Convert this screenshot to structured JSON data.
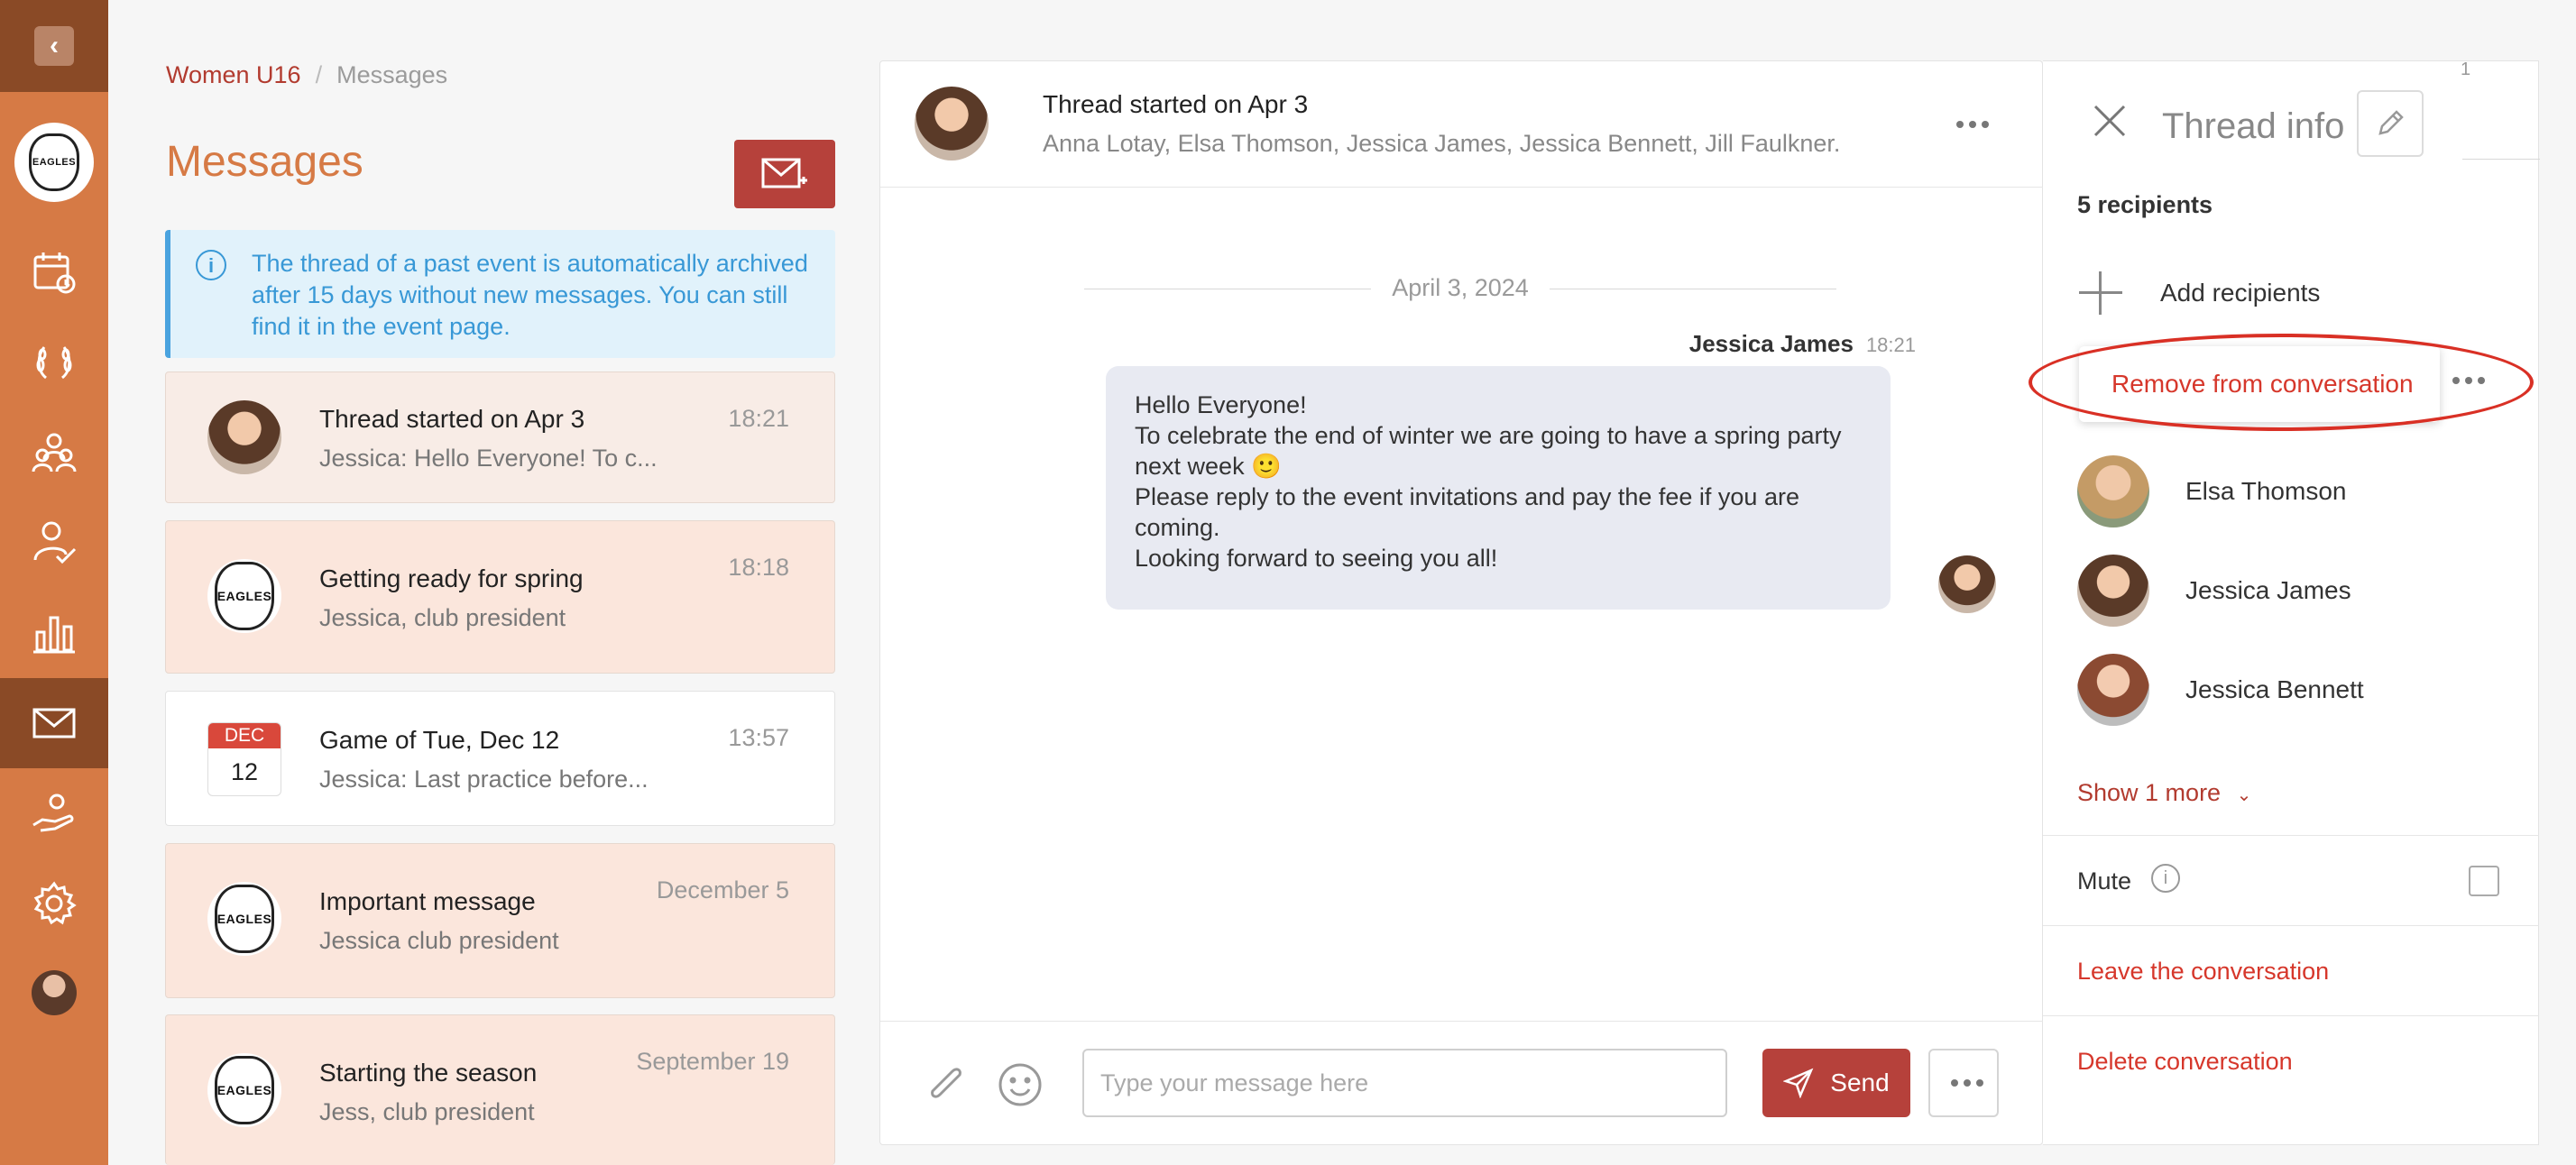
{
  "sidebar": {
    "back_icon": "chevron-left-icon",
    "logo_text": "EAGLES",
    "items": [
      {
        "icon": "calendar-icon"
      },
      {
        "icon": "laurel-icon"
      },
      {
        "icon": "team-icon"
      },
      {
        "icon": "attendance-icon"
      },
      {
        "icon": "stats-icon"
      },
      {
        "icon": "mail-icon",
        "active": true
      },
      {
        "icon": "hand-heart-icon"
      },
      {
        "icon": "gear-icon"
      }
    ]
  },
  "breadcrumb": {
    "team": "Women U16",
    "sep": "/",
    "page": "Messages"
  },
  "page_title": "Messages",
  "info_banner": "The thread of a past event is automatically archived after 15 days without new messages. You can still find it in the event page.",
  "threads": [
    {
      "title": "Thread started on Apr 3",
      "preview": "Jessica: Hello Everyone! To c...",
      "time": "18:21"
    },
    {
      "title": "Getting ready for spring",
      "preview": "Jessica, club president",
      "time": "18:18",
      "logo_text": "EAGLES"
    },
    {
      "title": "Game of Tue, Dec 12",
      "preview": "Jessica: Last practice before...",
      "time": "13:57",
      "cal_month": "DEC",
      "cal_day": "12"
    },
    {
      "title": "Important message",
      "preview": "Jessica club president",
      "time": "December 5",
      "logo_text": "EAGLES"
    },
    {
      "title": "Starting the season",
      "preview": "Jess, club president",
      "time": "September 19",
      "logo_text": "EAGLES"
    }
  ],
  "conversation": {
    "title": "Thread started on Apr 3",
    "participants": "Anna Lotay, Elsa Thomson, Jessica James, Jessica Bennett, Jill Faulkner.",
    "date_separator": "April 3, 2024",
    "message": {
      "author": "Jessica James",
      "time": "18:21",
      "lines": [
        "Hello Everyone!",
        "To celebrate the end of winter we are going to have a spring party next week 🙂",
        "Please reply to the event invitations and pay the fee if you are coming.",
        "Looking forward to seeing you all!"
      ]
    },
    "composer": {
      "placeholder": "Type your message here",
      "send_label": "Send"
    }
  },
  "thread_info": {
    "title": "Thread info",
    "corner_number": "1",
    "recipients_count": "5 recipients",
    "add_recipients": "Add recipients",
    "remove_popup": "Remove from conversation",
    "recipients": [
      "Elsa Thomson",
      "Jessica James",
      "Jessica Bennett"
    ],
    "show_more": "Show 1 more",
    "mute_label": "Mute",
    "leave": "Leave the conversation",
    "delete": "Delete conversation"
  },
  "colors": {
    "sidebar": "#d67a45",
    "sidebar_dark": "#8a4a26",
    "accent_red": "#b6413b",
    "title_orange": "#d67a45",
    "info_blue": "#3898d6"
  }
}
